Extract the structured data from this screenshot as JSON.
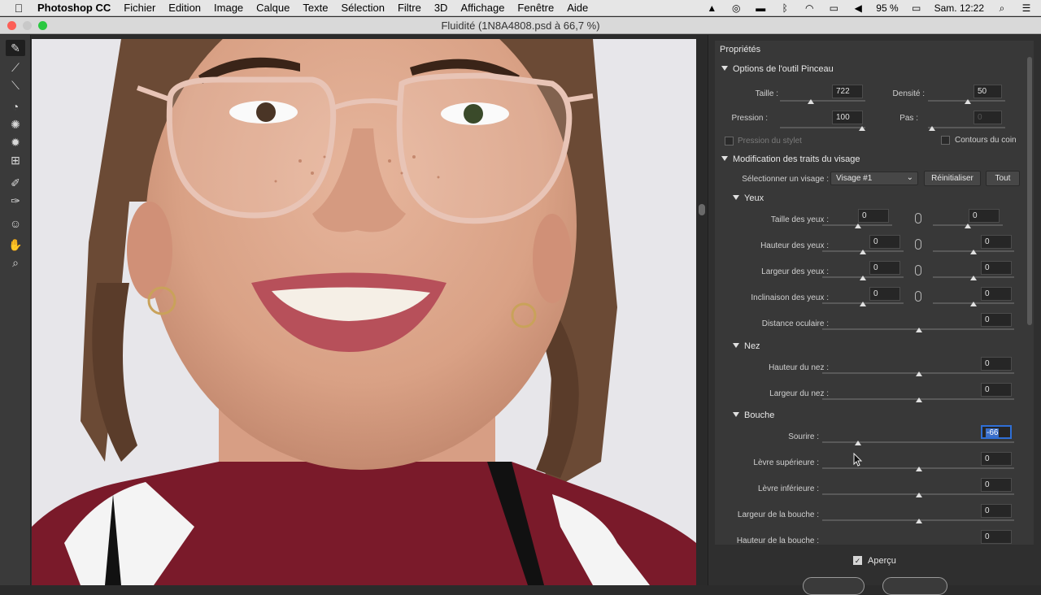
{
  "menubar": {
    "app_name": "Photoshop CC",
    "items": [
      "Fichier",
      "Edition",
      "Image",
      "Calque",
      "Texte",
      "Sélection",
      "Filtre",
      "3D",
      "Affichage",
      "Fenêtre",
      "Aide"
    ],
    "battery": "95 %",
    "clock": "Sam. 12:22"
  },
  "window": {
    "title": "Fluidité (1N8A4808.psd à 66,7 %)"
  },
  "panel": {
    "title": "Propriétés",
    "brush_options": {
      "header": "Options de l'outil Pinceau",
      "taille_label": "Taille :",
      "taille_value": "722",
      "densite_label": "Densité :",
      "densite_value": "50",
      "pression_label": "Pression :",
      "pression_value": "100",
      "pas_label": "Pas :",
      "pas_value": "0",
      "stylet_label": "Pression du stylet",
      "contours_label": "Contours du coin"
    },
    "face": {
      "header": "Modification des traits du visage",
      "select_label": "Sélectionner un visage :",
      "select_value": "Visage #1",
      "reset_label": "Réinitialiser",
      "all_label": "Tout"
    },
    "eyes": {
      "header": "Yeux",
      "rows": [
        {
          "label": "Taille des yeux :",
          "left": "0",
          "right": "0"
        },
        {
          "label": "Hauteur des yeux :",
          "left": "0",
          "right": "0"
        },
        {
          "label": "Largeur des yeux :",
          "left": "0",
          "right": "0"
        },
        {
          "label": "Inclinaison des yeux :",
          "left": "0",
          "right": "0"
        }
      ],
      "distance_label": "Distance oculaire :",
      "distance_value": "0"
    },
    "nose": {
      "header": "Nez",
      "hauteur_label": "Hauteur du nez :",
      "hauteur_value": "0",
      "largeur_label": "Largeur du nez :",
      "largeur_value": "0"
    },
    "mouth": {
      "header": "Bouche",
      "sourire_label": "Sourire :",
      "sourire_value": "-66",
      "sup_label": "Lèvre supérieure :",
      "sup_value": "0",
      "inf_label": "Lèvre inférieure :",
      "inf_value": "0",
      "largeur_label": "Largeur de la bouche :",
      "largeur_value": "0",
      "hauteur_label": "Hauteur de la bouche :",
      "hauteur_value": "0"
    },
    "preview_label": "Aperçu"
  },
  "colors": {
    "menubar_bg": "#e6e6e6",
    "panel_bg": "#383838",
    "accent_selection": "#2f6fd6",
    "close_dot": "#fc5f57",
    "zoom_dot": "#2ac840"
  }
}
